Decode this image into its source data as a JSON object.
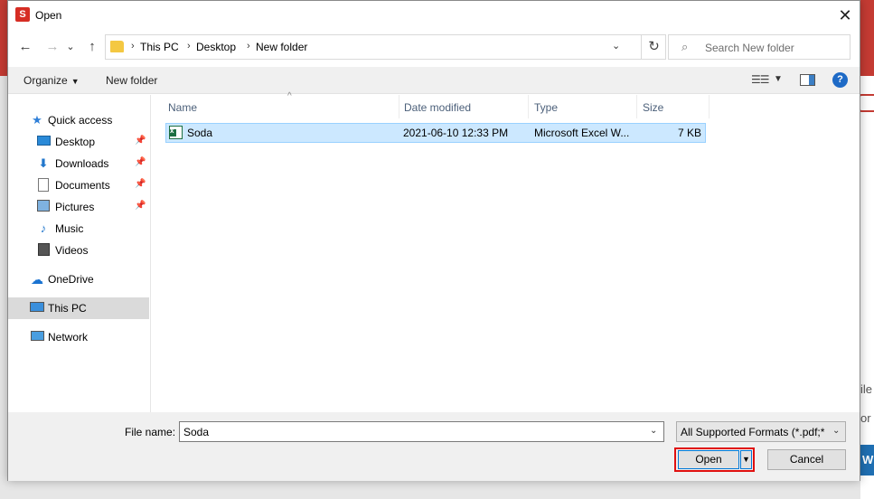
{
  "dialog": {
    "title": "Open",
    "app_icon_letter": "S",
    "close_glyph": "✕"
  },
  "nav": {
    "back": "←",
    "forward": "→",
    "recent_dd": "⌄",
    "up": "↑",
    "breadcrumb": [
      "This PC",
      "Desktop",
      "New folder"
    ],
    "refresh": "↻",
    "search_placeholder": "Search New folder"
  },
  "toolbar": {
    "organize": "Organize",
    "new_folder": "New folder"
  },
  "sidebar": {
    "items": [
      {
        "label": "Quick access",
        "icon": "star-icon"
      },
      {
        "label": "Desktop",
        "icon": "desktop-icon",
        "pinned": true
      },
      {
        "label": "Downloads",
        "icon": "download-icon",
        "pinned": true
      },
      {
        "label": "Documents",
        "icon": "documents-icon",
        "pinned": true
      },
      {
        "label": "Pictures",
        "icon": "pictures-icon",
        "pinned": true
      },
      {
        "label": "Music",
        "icon": "music-icon"
      },
      {
        "label": "Videos",
        "icon": "videos-icon"
      },
      {
        "label": "OneDrive",
        "icon": "cloud-icon"
      },
      {
        "label": "This PC",
        "icon": "computer-icon",
        "selected": true
      },
      {
        "label": "Network",
        "icon": "network-icon"
      }
    ]
  },
  "columns": [
    "Name",
    "Date modified",
    "Type",
    "Size"
  ],
  "files": [
    {
      "name": "Soda",
      "date_modified": "2021-06-10 12:33 PM",
      "type": "Microsoft Excel W...",
      "size": "7 KB"
    }
  ],
  "bottom": {
    "file_name_label": "File name:",
    "file_name_value": "Soda",
    "filter": "All Supported Formats (*.pdf;*.c",
    "open_label": "Open",
    "cancel_label": "Cancel"
  },
  "background_app": {
    "fragment_1": "ile",
    "fragment_2": "or",
    "fragment_3": "W"
  },
  "colors": {
    "accent": "#0078d7",
    "selection": "#cce8ff",
    "highlight_outline": "#e01010",
    "app_brand": "#c43b33"
  }
}
